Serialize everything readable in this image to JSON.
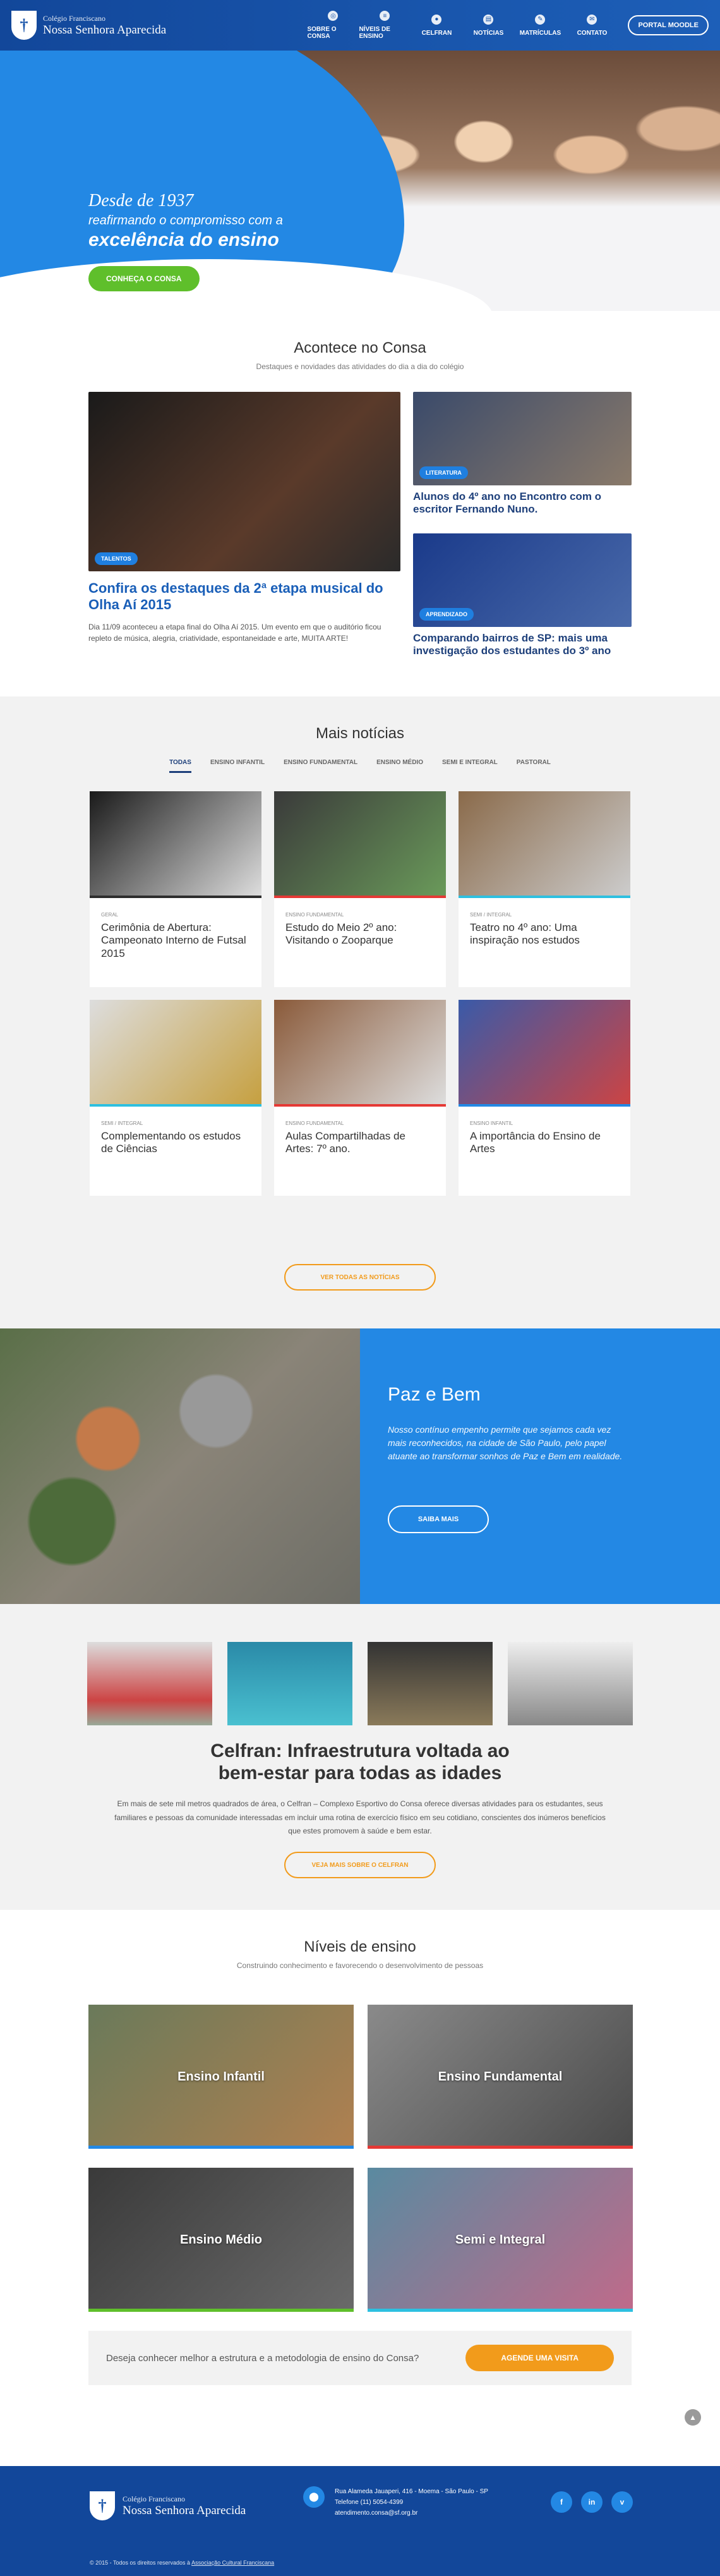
{
  "header": {
    "logo_line1": "Colégio Franciscano",
    "logo_line2": "Nossa Senhora Aparecida",
    "nav": [
      "SOBRE O CONSA",
      "NÍVEIS DE ENSINO",
      "CELFRAN",
      "NOTÍCIAS",
      "MATRÍCULAS",
      "CONTATO"
    ],
    "portal_button": "PORTAL MOODLE"
  },
  "hero": {
    "line1": "Desde de 1937",
    "line2": "reafirmando o compromisso com a",
    "line3": "excelência do ensino",
    "button": "CONHEÇA O CONSA"
  },
  "acontece": {
    "title": "Acontece no Consa",
    "subtitle": "Destaques e novidades das atividades do dia a dia do colégio",
    "main_tag": "TALENTOS",
    "main_title": "Confira os destaques da 2ª etapa musical do Olha Aí 2015",
    "main_text": "Dia 11/09 aconteceu a etapa final do Olha Aí 2015. Um evento em que o auditório ficou repleto de música, alegria, criatividade, espontaneidade e arte, MUITA ARTE!",
    "side": [
      {
        "tag": "LITERATURA",
        "title": "Alunos do 4º ano no Encontro com o escritor Fernando Nuno."
      },
      {
        "tag": "APRENDIZADO",
        "title": "Comparando bairros de SP: mais uma investigação dos estudantes do 3º ano"
      }
    ]
  },
  "mais": {
    "title": "Mais notícias",
    "tabs": [
      "TODAS",
      "ENSINO INFANTIL",
      "ENSINO FUNDAMENTAL",
      "ENSINO MÉDIO",
      "SEMI E INTEGRAL",
      "PASTORAL"
    ],
    "cards": [
      {
        "cat": "GERAL",
        "title": "Cerimônia de Abertura: Campeonato Interno de Futsal 2015",
        "color": "#2d2d2d"
      },
      {
        "cat": "ENSINO FUNDAMENTAL",
        "title": "Estudo do Meio 2º ano: Visitando o Zooparque",
        "color": "#e53935"
      },
      {
        "cat": "SEMI / INTEGRAL",
        "title": "Teatro no 4º ano: Uma inspiração nos estudos",
        "color": "#2dc0e0"
      },
      {
        "cat": "SEMI / INTEGRAL",
        "title": "Complementando os estudos de Ciências",
        "color": "#2dc0e0"
      },
      {
        "cat": "ENSINO FUNDAMENTAL",
        "title": "Aulas Compartilhadas de Artes: 7º ano.",
        "color": "#e53935"
      },
      {
        "cat": "ENSINO INFANTIL",
        "title": "A importância do Ensino de Artes",
        "color": "#2388e4"
      }
    ],
    "button": "VER TODAS AS NOTÍCIAS"
  },
  "paz": {
    "title": "Paz e Bem",
    "text": "Nosso contínuo empenho permite que sejamos cada vez mais reconhecidos, na cidade de São Paulo, pelo papel atuante ao transformar sonhos de Paz e Bem em realidade.",
    "button": "SAIBA MAIS"
  },
  "celfran": {
    "title_l1": "Celfran: Infraestrutura voltada ao",
    "title_l2": "bem-estar para todas as idades",
    "text": "Em mais de sete mil metros quadrados de área, o Celfran – Complexo Esportivo do Consa oferece diversas atividades para os estudantes, seus familiares e pessoas da comunidade interessadas em incluir uma rotina de exercício físico em seu cotidiano, conscientes dos inúmeros benefícios que estes promovem à saúde e bem estar.",
    "button": "VEJA MAIS SOBRE O CELFRAN"
  },
  "niveis": {
    "title": "Níveis de ensino",
    "subtitle": "Construindo conhecimento e favorecendo o desenvolvimento de pessoas",
    "items": [
      {
        "label": "Ensino Infantil",
        "color": "#2388e4"
      },
      {
        "label": "Ensino Fundamental",
        "color": "#e53935"
      },
      {
        "label": "Ensino Médio",
        "color": "#5fbf2b"
      },
      {
        "label": "Semi e Integral",
        "color": "#2dc0e0"
      }
    ],
    "cta_text": "Deseja conhecer melhor a estrutura e a metodologia de ensino do Consa?",
    "cta_button": "AGENDE UMA VISITA"
  },
  "footer": {
    "logo_line1": "Colégio Franciscano",
    "logo_line2": "Nossa Senhora Aparecida",
    "address": "Rua Alameda Jauaperi, 416 - Moema - São Paulo - SP",
    "phone": "Telefone (11) 5054-4399",
    "email": "atendimento.consa@sf.org.br",
    "socials": [
      "f",
      "in",
      "v"
    ],
    "copyright": "© 2015 - Todos os direitos reservados à",
    "copyright_link": "Associação Cultural Franciscana"
  }
}
